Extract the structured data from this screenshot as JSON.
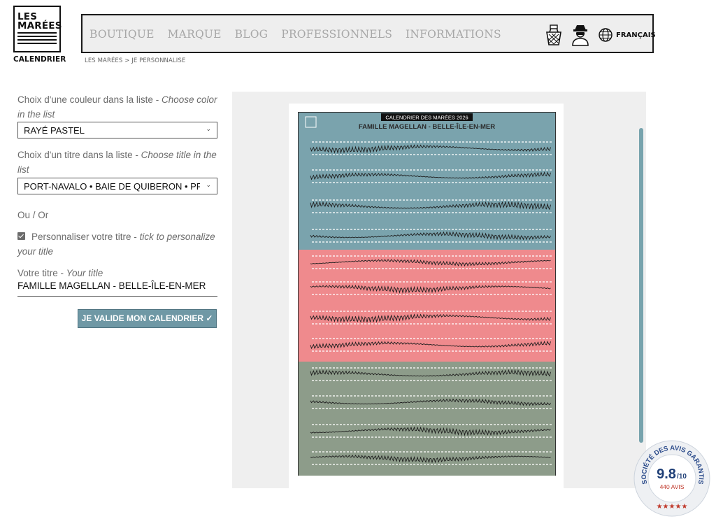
{
  "logo": {
    "line1": "LES",
    "line2": "MARÉES",
    "sub": "CALENDRIER"
  },
  "nav": {
    "items": [
      "BOUTIQUE",
      "MARQUE",
      "BLOG",
      "PROFESSIONNELS",
      "INFORMATIONS"
    ],
    "language": "FRANÇAIS"
  },
  "breadcrumb": "LES MARÉES > JE PERSONNALISE",
  "form": {
    "color_label": "Choix d'une couleur dans la liste - ",
    "color_label_en": "Choose color in the list",
    "color_value": "RAYÉ PASTEL",
    "title_label": "Choix d'un titre dans la liste - ",
    "title_label_en": "Choose title in the list",
    "title_value": "PORT-NAVALO • BAIE DE QUIBERON • PRESQU'ÎLE",
    "or_label": "Ou / Or",
    "personalize_label": "Personnaliser votre titre - ",
    "personalize_label_en": "tick to personalize your title",
    "personalize_checked": true,
    "your_title_label": "Votre titre - ",
    "your_title_label_en": "Your title",
    "your_title_value": "FAMILLE MAGELLAN - BELLE-ÎLE-EN-MER",
    "submit_label": "JE VALIDE MON CALENDRIER ✓"
  },
  "poster": {
    "header": "CALENDRIER DES MARÉES 2026",
    "title": "FAMILLE MAGELLAN - BELLE-ÎLE-EN-MER",
    "bands": [
      {
        "color": "#7aa3ad",
        "months": 4
      },
      {
        "color": "#ef8a8d",
        "months": 4
      },
      {
        "color": "#8d9c8a",
        "months": 4
      }
    ]
  },
  "badge": {
    "ring_text": "SOCIÉTÉ DES AVIS GARANTIS",
    "score": "9.8",
    "scale": "/10",
    "count": "440 AVIS",
    "stars": "★★★★★"
  }
}
